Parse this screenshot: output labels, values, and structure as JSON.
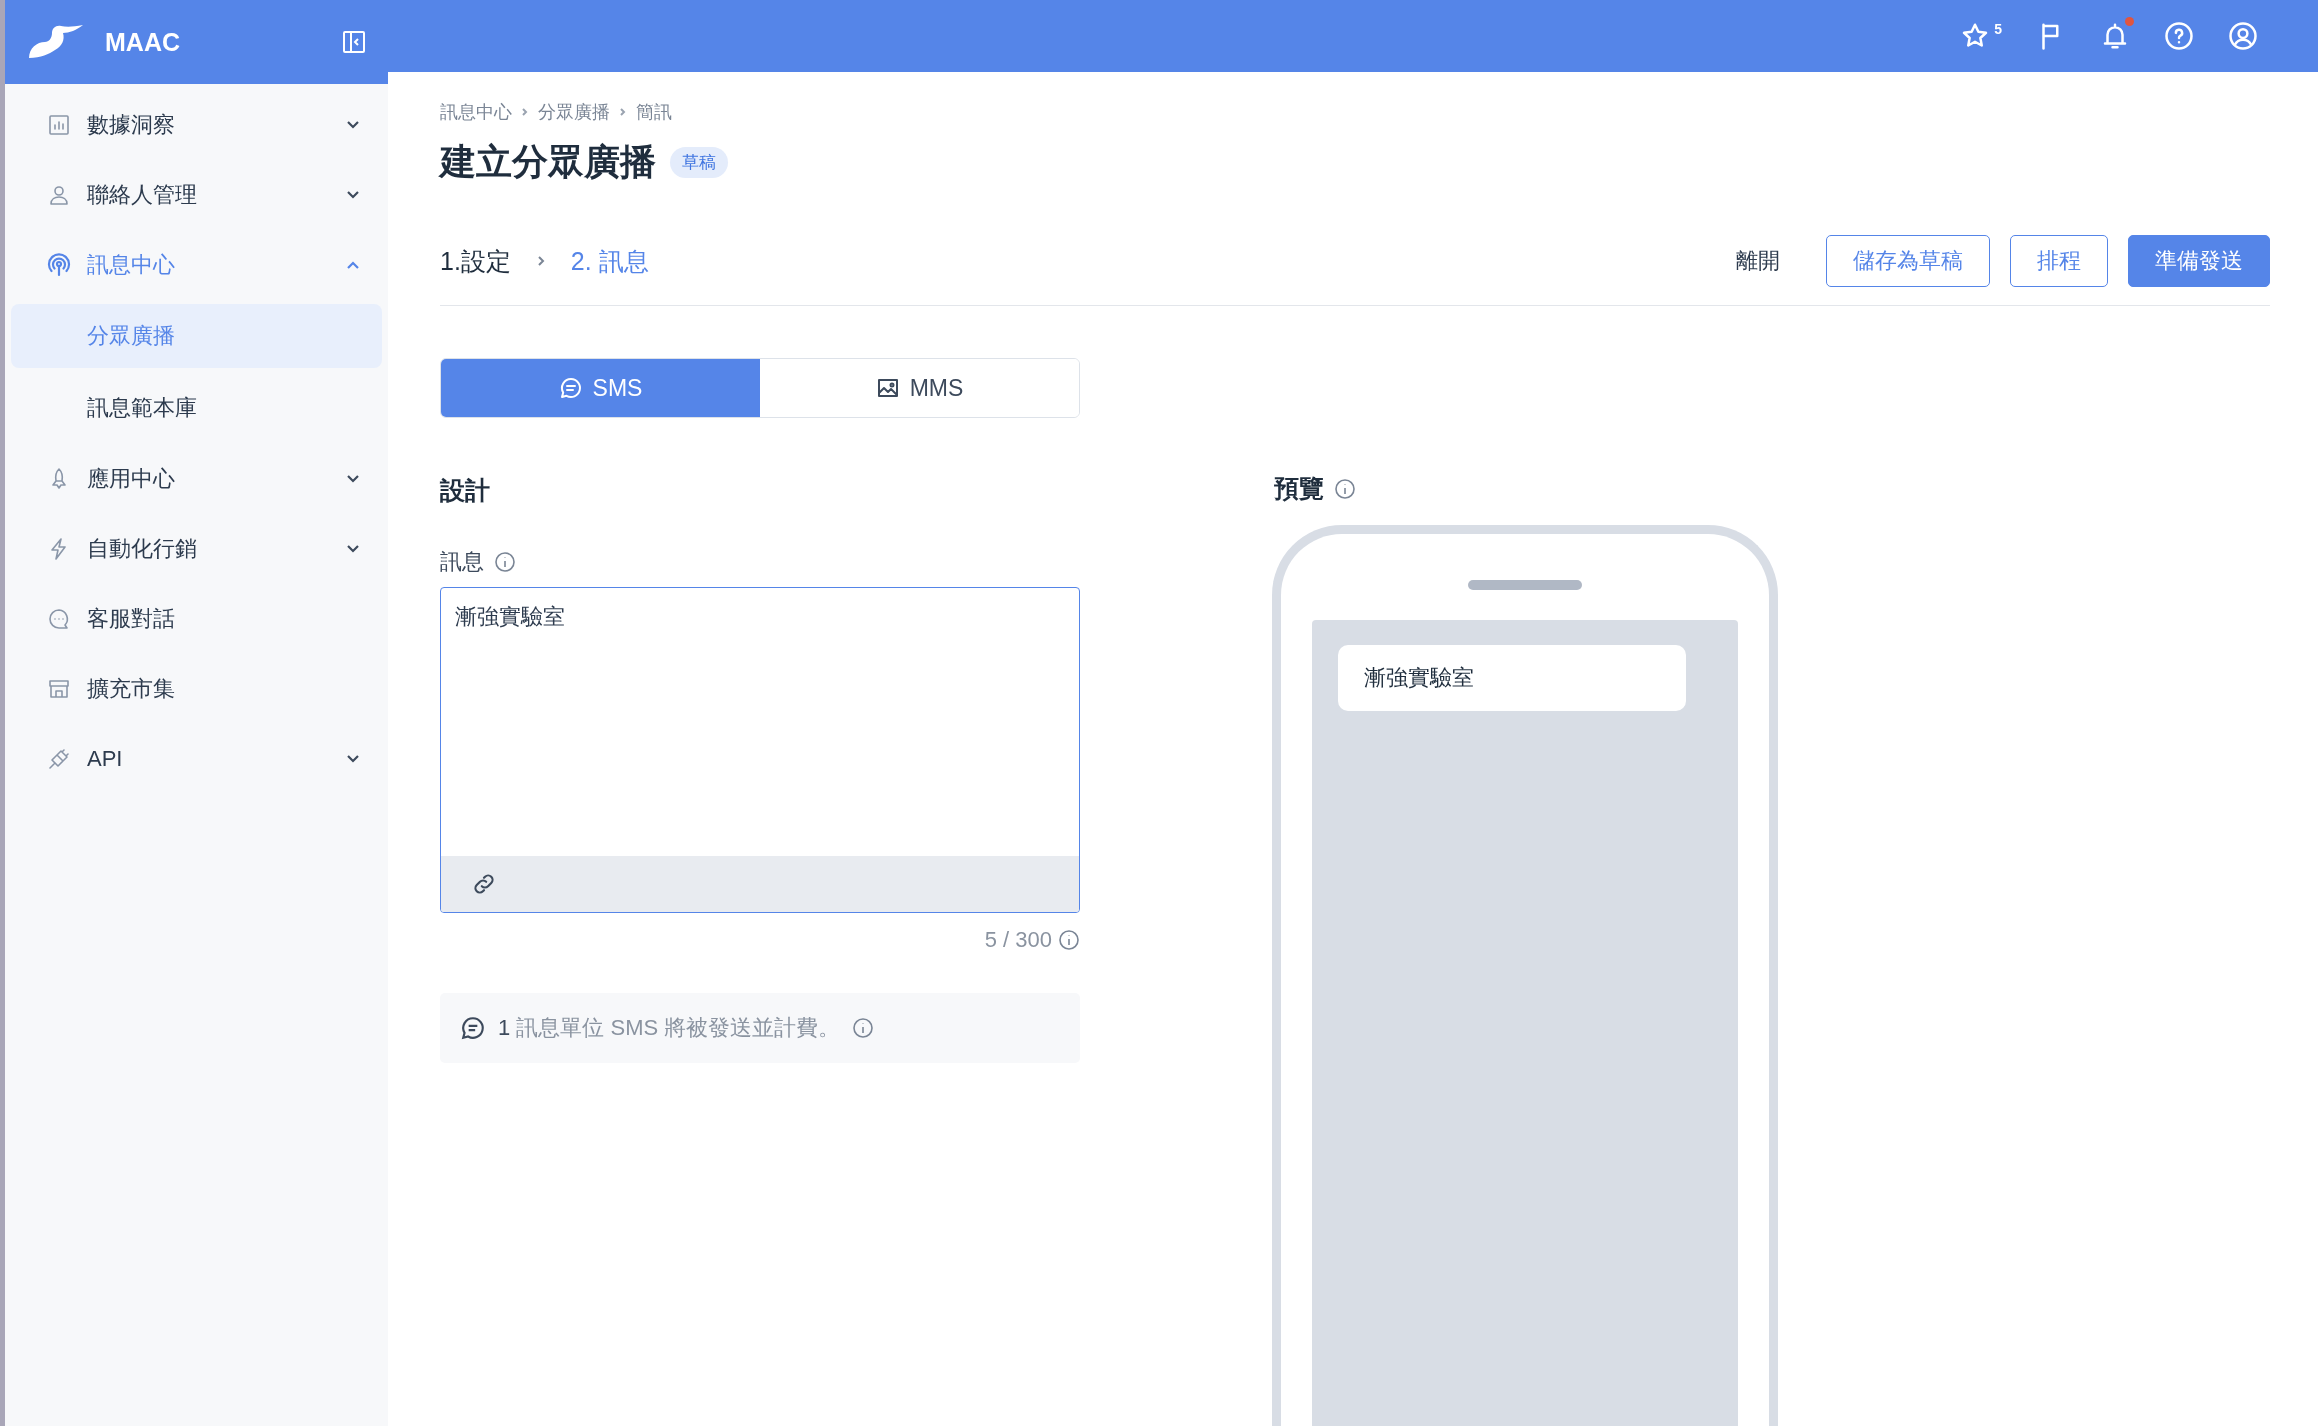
{
  "app": {
    "name": "MAAC"
  },
  "sidebar": {
    "items": [
      {
        "label": "數據洞察",
        "kind": "group",
        "expanded": false,
        "active": false
      },
      {
        "label": "聯絡人管理",
        "kind": "group",
        "expanded": false,
        "active": false
      },
      {
        "label": "訊息中心",
        "kind": "group",
        "expanded": true,
        "active": true,
        "children": [
          {
            "label": "分眾廣播",
            "selected": true
          },
          {
            "label": "訊息範本庫",
            "selected": false
          }
        ]
      },
      {
        "label": "應用中心",
        "kind": "group",
        "expanded": false,
        "active": false
      },
      {
        "label": "自動化行銷",
        "kind": "group",
        "expanded": false,
        "active": false
      },
      {
        "label": "客服對話",
        "kind": "link",
        "active": false
      },
      {
        "label": "擴充市集",
        "kind": "link",
        "active": false
      },
      {
        "label": "API",
        "kind": "group",
        "expanded": false,
        "active": false
      }
    ]
  },
  "topbar": {
    "favorites_count": "5",
    "has_unread": true
  },
  "breadcrumb": [
    "訊息中心",
    "分眾廣播",
    "簡訊"
  ],
  "title": "建立分眾廣播",
  "badge": "草稿",
  "steps": [
    {
      "label": "1.設定",
      "selected": false
    },
    {
      "label": "2. 訊息",
      "selected": true
    }
  ],
  "actions": [
    {
      "label": "離開",
      "kind": "text"
    },
    {
      "label": "儲存為草稿",
      "kind": "outline"
    },
    {
      "label": "排程",
      "kind": "outline"
    },
    {
      "label": "準備發送",
      "kind": "primary"
    }
  ],
  "tabs": [
    {
      "label": "SMS",
      "selected": true
    },
    {
      "label": "MMS",
      "selected": false
    }
  ],
  "design": {
    "heading": "設計",
    "field_label": "訊息",
    "value": "漸強實驗室",
    "counter": "5 / 300",
    "notice": "**1** 訊息單位 SMS 將被發送並計費。"
  },
  "preview": {
    "heading": "預覽",
    "bubble": "漸強實驗室"
  }
}
